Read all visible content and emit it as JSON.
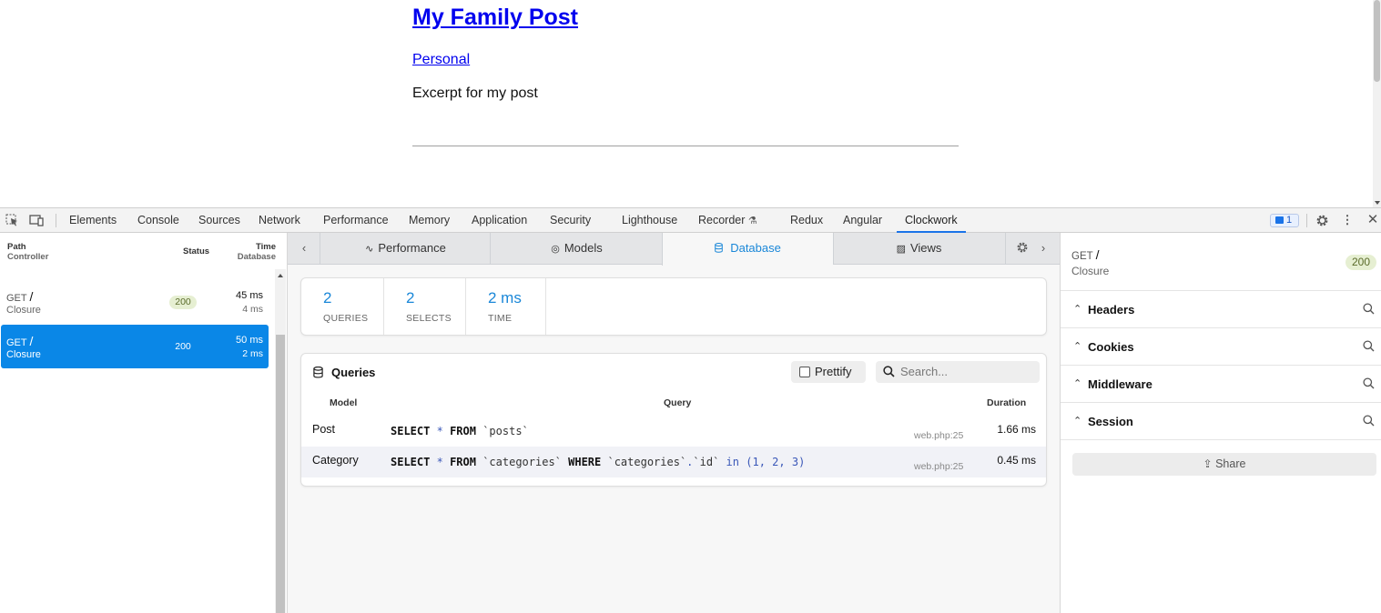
{
  "page": {
    "title": "My Family Post",
    "category": "Personal",
    "excerpt": "Excerpt for my post"
  },
  "devtools": {
    "tabs": [
      "Elements",
      "Console",
      "Sources",
      "Network",
      "Performance",
      "Memory",
      "Application",
      "Security",
      "Lighthouse",
      "Recorder",
      "Redux",
      "Angular",
      "Clockwork"
    ],
    "active_tab": "Clockwork",
    "issues_count": "1"
  },
  "requests": {
    "headers": {
      "path": "Path",
      "controller": "Controller",
      "status": "Status",
      "time": "Time",
      "database": "Database"
    },
    "rows": [
      {
        "method": "GET",
        "path": "/",
        "controller": "Closure",
        "status": "200",
        "time": "45 ms",
        "db": "4 ms",
        "selected": false
      },
      {
        "method": "GET",
        "path": "/",
        "controller": "Closure",
        "status": "200",
        "time": "50 ms",
        "db": "2 ms",
        "selected": true
      }
    ]
  },
  "clockwork": {
    "tabs": [
      "Performance",
      "Models",
      "Database",
      "Views"
    ],
    "active_tab": "Database",
    "stats": [
      {
        "value": "2",
        "label": "QUERIES"
      },
      {
        "value": "2",
        "label": "SELECTS"
      },
      {
        "value": "2 ms",
        "label": "TIME"
      }
    ],
    "queries": {
      "title": "Queries",
      "prettify_label": "Prettify",
      "search_placeholder": "Search...",
      "columns": {
        "model": "Model",
        "query": "Query",
        "duration": "Duration"
      },
      "rows": [
        {
          "model": "Post",
          "file": "web.php:25",
          "duration": "1.66 ms"
        },
        {
          "model": "Category",
          "file": "web.php:25",
          "duration": "0.45 ms"
        }
      ]
    }
  },
  "details": {
    "method": "GET",
    "path": "/",
    "controller": "Closure",
    "status": "200",
    "sections": [
      "Headers",
      "Cookies",
      "Middleware",
      "Session"
    ],
    "share_label": "Share"
  },
  "colors": {
    "accent": "#1a87d8",
    "selected_row": "#0a87e7",
    "status_badge_bg": "#e6efd2",
    "link": "#0000ee"
  }
}
